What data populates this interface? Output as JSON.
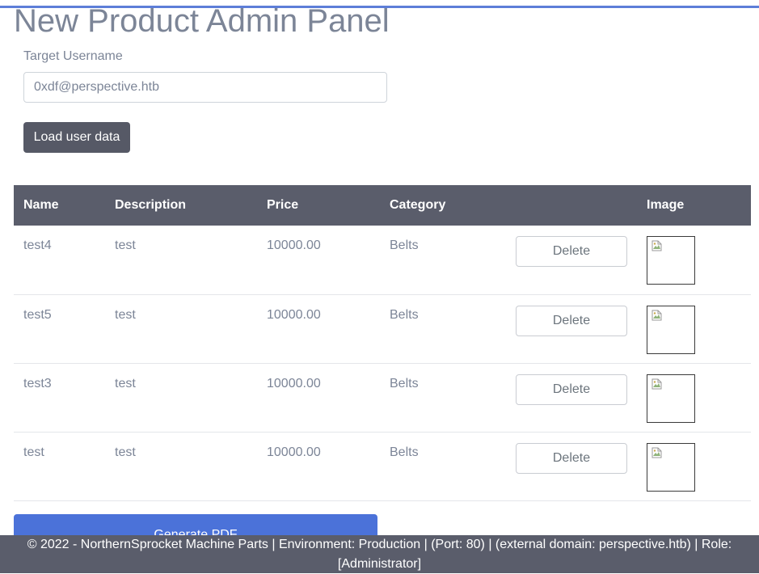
{
  "colors": {
    "accent_line": "#5d7ed8",
    "header_bg": "#5a5d6b",
    "primary_button": "#4b72d9",
    "dark_button": "#565966"
  },
  "page": {
    "title": "New Product Admin Panel"
  },
  "form": {
    "label": "Target Username",
    "value": "0xdf@perspective.htb",
    "load_button": "Load user data"
  },
  "table": {
    "headers": {
      "name": "Name",
      "description": "Description",
      "price": "Price",
      "category": "Category",
      "action": "",
      "image": "Image"
    },
    "rows": [
      {
        "name": "test4",
        "description": "test",
        "price": "10000.00",
        "category": "Belts",
        "action": "Delete",
        "image_icon": "broken-image-icon"
      },
      {
        "name": "test5",
        "description": "test",
        "price": "10000.00",
        "category": "Belts",
        "action": "Delete",
        "image_icon": "broken-image-icon"
      },
      {
        "name": "test3",
        "description": "test",
        "price": "10000.00",
        "category": "Belts",
        "action": "Delete",
        "image_icon": "broken-image-icon"
      },
      {
        "name": "test",
        "description": "test",
        "price": "10000.00",
        "category": "Belts",
        "action": "Delete",
        "image_icon": "broken-image-icon"
      }
    ]
  },
  "actions": {
    "generate_pdf": "Generate PDF"
  },
  "footer": {
    "text": "© 2022 - NorthernSprocket Machine Parts | Environment: Production | (Port: 80) | (external domain: perspective.htb) | Role: [Administrator]"
  }
}
